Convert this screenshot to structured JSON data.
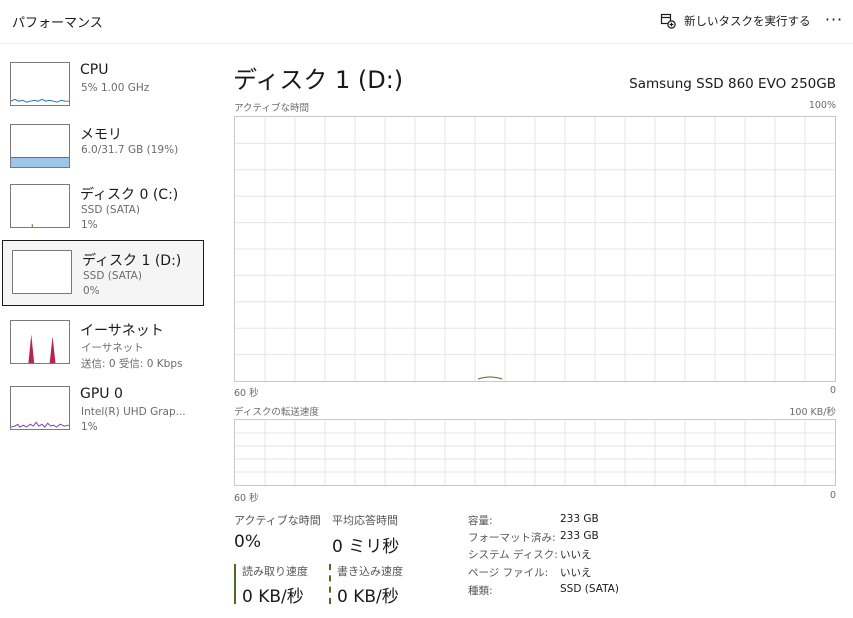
{
  "header": {
    "title": "パフォーマンス",
    "run_task_label": "新しいタスクを実行する",
    "more_label": "···"
  },
  "sidebar": {
    "items": [
      {
        "name": "CPU",
        "sub1": "5%  1.00 GHz"
      },
      {
        "name": "メモリ",
        "sub1": "6.0/31.7 GB (19%)"
      },
      {
        "name": "ディスク 0 (C:)",
        "sub1": "SSD (SATA)",
        "sub2": "1%"
      },
      {
        "name": "ディスク 1 (D:)",
        "sub1": "SSD (SATA)",
        "sub2": "0%"
      },
      {
        "name": "イーサネット",
        "sub1": "イーサネット",
        "sub2": "送信: 0 受信: 0 Kbps"
      },
      {
        "name": "GPU 0",
        "sub1": "Intel(R) UHD Grap...",
        "sub2": "1%"
      }
    ]
  },
  "main": {
    "title": "ディスク 1 (D:)",
    "model": "Samsung SSD 860 EVO 250GB",
    "active_graph": {
      "label": "アクティブな時間",
      "max": "100%",
      "time": "60 秒",
      "min": "0"
    },
    "transfer_graph": {
      "label": "ディスクの転送速度",
      "max": "100 KB/秒",
      "time": "60 秒",
      "min": "0"
    },
    "stats": {
      "active_time": {
        "label": "アクティブな時間",
        "value": "0%"
      },
      "avg_response": {
        "label": "平均応答時間",
        "value": "0 ミリ秒"
      },
      "read_speed": {
        "label": "読み取り速度",
        "value": "0 KB/秒"
      },
      "write_speed": {
        "label": "書き込み速度",
        "value": "0 KB/秒"
      }
    },
    "properties": [
      {
        "label": "容量:",
        "value": "233 GB"
      },
      {
        "label": "フォーマット済み:",
        "value": "233 GB"
      },
      {
        "label": "システム ディスク:",
        "value": "いいえ"
      },
      {
        "label": "ページ ファイル:",
        "value": "いいえ"
      },
      {
        "label": "種類:",
        "value": "SSD (SATA)"
      }
    ]
  },
  "colors": {
    "accent_disk": "#4e6b1f",
    "cpu_line": "#1f78b4",
    "memory_fill": "#9fc6e8",
    "ethernet_line": "#a0153e",
    "gpu_line": "#7a3fb0",
    "grid": "#e6e6e6"
  }
}
